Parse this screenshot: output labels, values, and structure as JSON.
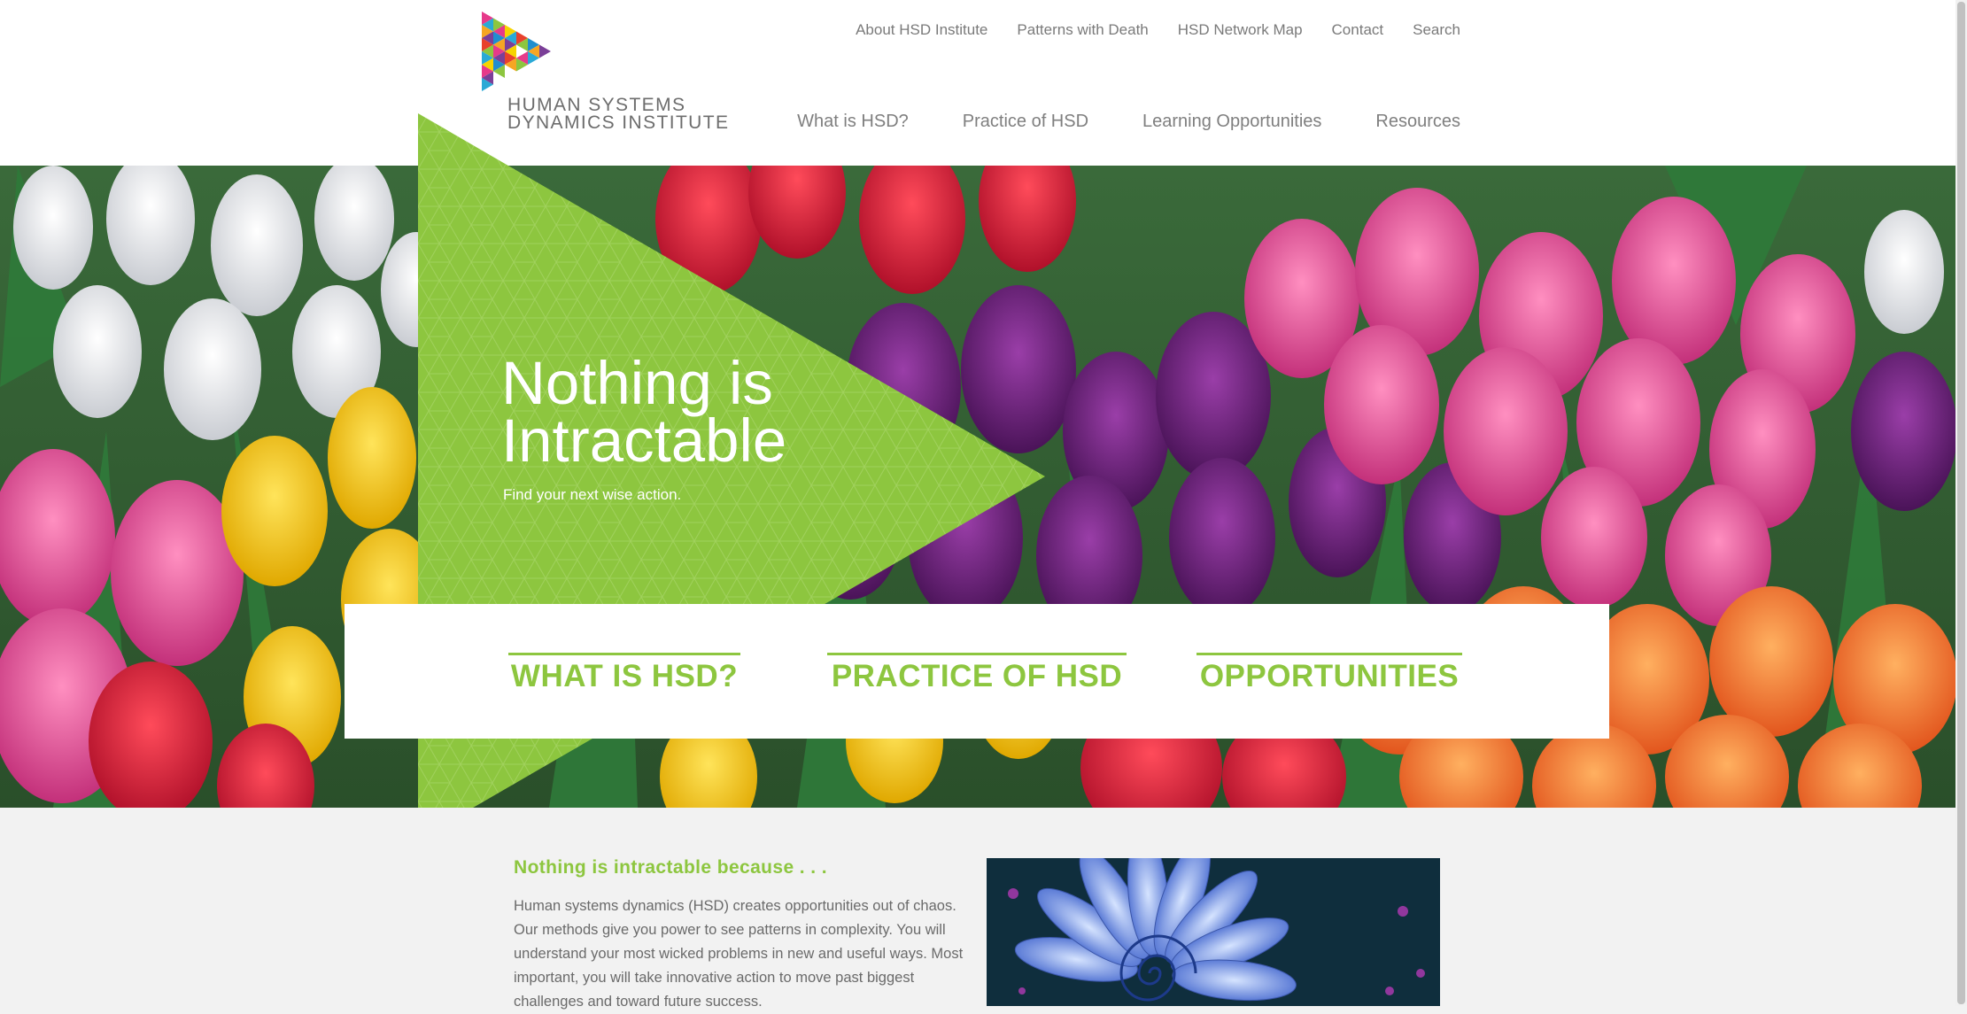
{
  "brand": {
    "name_line1": "HUMAN SYSTEMS",
    "name_line2": "DYNAMICS INSTITUTE",
    "logo_icon": "triangle-mosaic-logo"
  },
  "utility_nav": [
    "About HSD Institute",
    "Patterns with Death",
    "HSD Network Map",
    "Contact",
    "Search"
  ],
  "main_nav": [
    "What is HSD?",
    "Practice of HSD",
    "Learning Opportunities",
    "Resources"
  ],
  "hero": {
    "title_line1": "Nothing is",
    "title_line2": "Intractable",
    "subtitle": "Find your next wise action.",
    "image": "tulip-field-photo"
  },
  "cta": [
    "WHAT IS HSD?",
    "PRACTICE OF HSD",
    "OPPORTUNITIES"
  ],
  "content": {
    "heading": "Nothing is intractable because . . .",
    "body": "Human systems dynamics (HSD) creates opportunities out of chaos. Our methods give you power to see patterns in complexity. You will understand your most wicked problems in new and useful ways. Most important, you will take innovative action to move past biggest challenges and toward future success.",
    "image": "blue-spiral-flower-photo"
  },
  "colors": {
    "accent_green": "#8dc63f",
    "nav_gray": "#7f7f7f",
    "white": "#ffffff"
  }
}
